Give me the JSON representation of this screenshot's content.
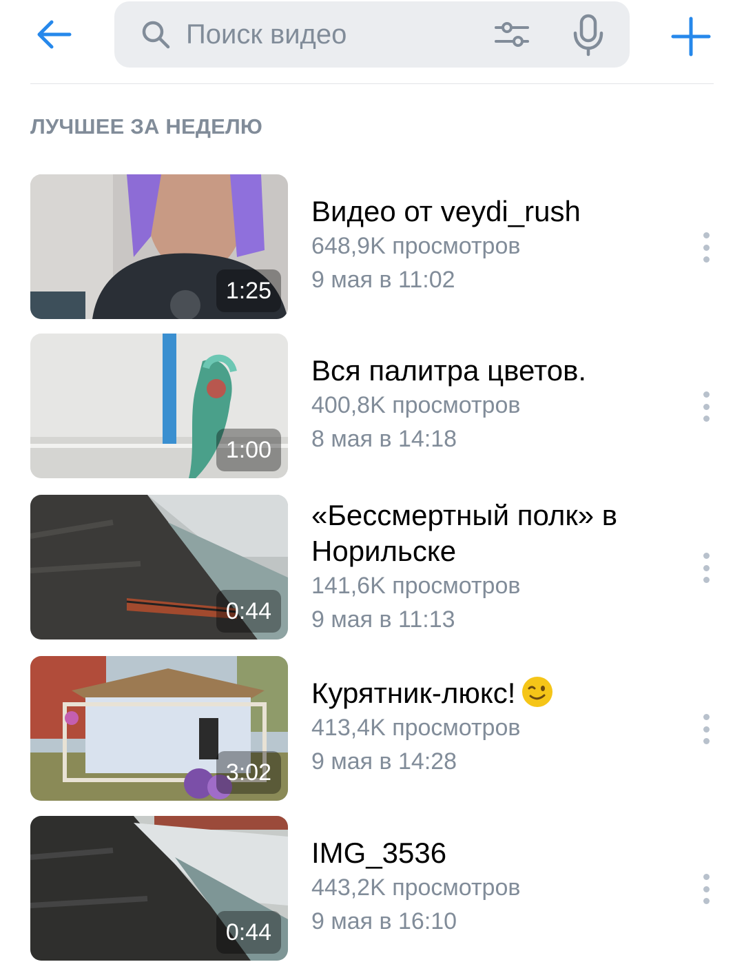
{
  "header": {
    "search_placeholder": "Поиск видео"
  },
  "section": {
    "title": "ЛУЧШЕЕ ЗА НЕДЕЛЮ"
  },
  "videos": [
    {
      "title": "Видео от veydi_rush",
      "views": "648,9K просмотров",
      "date": "9 мая в 11:02",
      "duration": "1:25"
    },
    {
      "title": "Вся палитра цветов.",
      "views": "400,8K просмотров",
      "date": "8 мая в 14:18",
      "duration": "1:00"
    },
    {
      "title": "«Бессмертный полк» в Норильске",
      "views": "141,6K просмотров",
      "date": "9 мая в 11:13",
      "duration": "0:44"
    },
    {
      "title": "Курятник-люкс!",
      "views": "413,4K просмотров",
      "date": "9 мая в 14:28",
      "duration": "3:02"
    },
    {
      "title": "IMG_3536",
      "views": "443,2K просмотров",
      "date": "9 мая в 16:10",
      "duration": "0:44"
    }
  ],
  "colors": {
    "accent": "#2688eb",
    "secondary_text": "#818c99",
    "search_bg": "#ebedf0"
  },
  "icons": [
    "back-arrow-icon",
    "search-icon",
    "filters-icon",
    "microphone-icon",
    "plus-icon",
    "more-vertical-icon",
    "wink-emoji-icon"
  ]
}
